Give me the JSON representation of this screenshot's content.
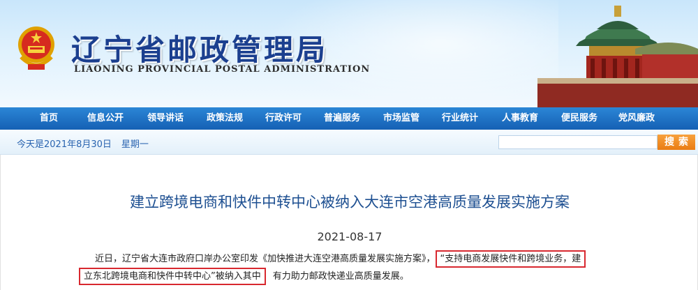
{
  "header": {
    "title": "辽宁省邮政管理局",
    "subtitle": "LIAONING PROVINCIAL POSTAL ADMINISTRATION"
  },
  "nav": {
    "items": [
      "首页",
      "信息公开",
      "领导讲话",
      "政策法规",
      "行政许可",
      "普遍服务",
      "市场监管",
      "行业统计",
      "人事教育",
      "便民服务",
      "党风廉政"
    ]
  },
  "infobar": {
    "date": "今天是2021年8月30日",
    "weekday": "星期一",
    "search_placeholder": "",
    "search_label": "搜索"
  },
  "article": {
    "title": "建立跨境电商和快件中转中心被纳入大连市空港高质量发展实施方案",
    "date": "2021-08-17",
    "line1_text": "近日，辽宁省大连市政府口岸办公室印发《加快推进大连空港高质量发展实施方案》，",
    "line1_highlight": "“支持电商发展快件和跨境业务，建",
    "line2_highlight": "立东北跨境电商和快件中转中心”被纳入其中",
    "line2_text": "有力助力邮政快递业高质量发展。"
  },
  "colors": {
    "title_blue": "#1b3f8f",
    "nav_blue": "#1560b4",
    "search_orange": "#ea7c12",
    "highlight_red": "#d8282f"
  }
}
